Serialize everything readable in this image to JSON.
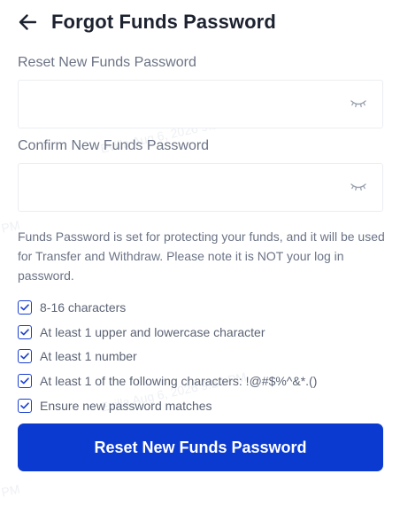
{
  "header": {
    "title": "Forgot Funds Password",
    "back_icon": "arrow-left-icon"
  },
  "reset_field": {
    "label": "Reset New Funds Password",
    "value": "",
    "toggle_icon": "eye-closed-icon"
  },
  "confirm_field": {
    "label": "Confirm New Funds Password",
    "value": "",
    "toggle_icon": "eye-closed-icon"
  },
  "info": "Funds Password is set for protecting your funds, and it will be used for Transfer and Withdraw. Please note it is NOT your log in password.",
  "requirements": [
    "8-16 characters",
    "At least 1 upper and lowercase character",
    "At least 1 number",
    "At least 1 of the following characters: !@#$%^&*.()",
    "Ensure new password matches"
  ],
  "watermarks": [
    "Evilla Aug 6, 2026 9:24 PM",
    "Evilla Aug 6, 2026 9:24 PM",
    "PM",
    "PM"
  ],
  "submit": {
    "label": "Reset New Funds Password"
  },
  "colors": {
    "primary": "#0a3ad0",
    "title": "#1c2230",
    "label": "#6b7385",
    "border": "#ebedf1"
  }
}
